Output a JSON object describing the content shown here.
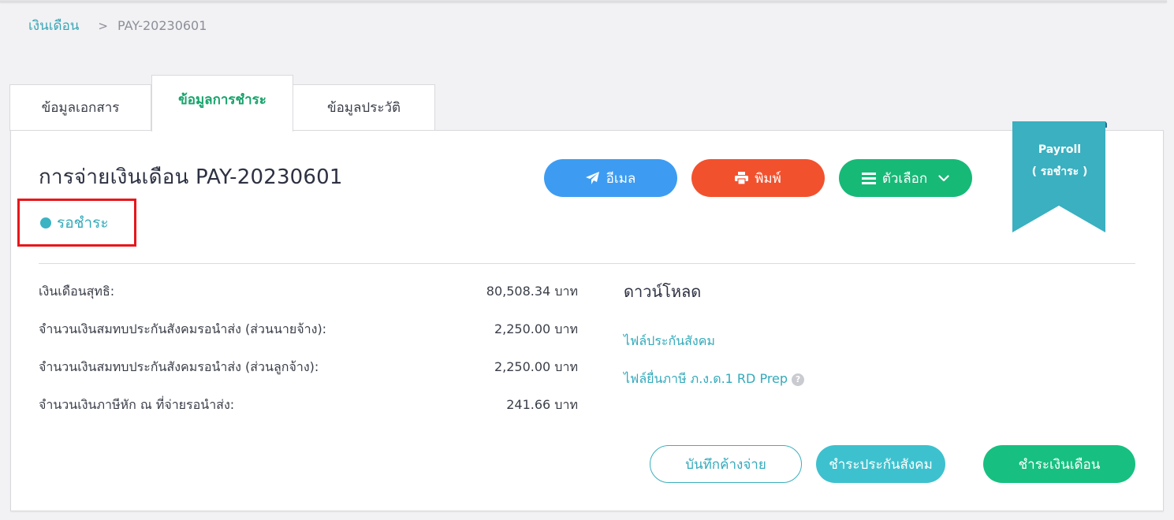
{
  "breadcrumb": {
    "parent": "เงินเดือน",
    "separator": ">",
    "current": "PAY-20230601"
  },
  "tabs": [
    {
      "label": "ข้อมูลเอกสาร",
      "active": false
    },
    {
      "label": "ข้อมูลการชำระ",
      "active": true
    },
    {
      "label": "ข้อมูลประวัติ",
      "active": false
    }
  ],
  "header": {
    "title": "การจ่ายเงินเดือน PAY-20230601",
    "status": "รอชำระ"
  },
  "actions": {
    "email_label": "อีเมล",
    "print_label": "พิมพ์",
    "options_label": "ตัวเลือก"
  },
  "ribbon": {
    "line1": "Payroll",
    "line2": "( รอชำระ )"
  },
  "summary": [
    {
      "label": "เงินเดือนสุทธิ:",
      "value": "80,508.34 บาท"
    },
    {
      "label": "จำนวนเงินสมทบประกันสังคมรอนำส่ง (ส่วนนายจ้าง):",
      "value": "2,250.00 บาท"
    },
    {
      "label": "จำนวนเงินสมทบประกันสังคมรอนำส่ง (ส่วนลูกจ้าง):",
      "value": "2,250.00 บาท"
    },
    {
      "label": "จำนวนเงินภาษีหัก ณ ที่จ่ายรอนำส่ง:",
      "value": "241.66 บาท"
    }
  ],
  "download": {
    "title": "ดาวน์โหลด",
    "links": [
      {
        "label": "ไฟล์ประกันสังคม"
      },
      {
        "label": "ไฟล์ยื่นภาษี ภ.ง.ด.1 RD Prep"
      }
    ]
  },
  "footer": {
    "record_pending_label": "บันทึกค้างจ่าย",
    "pay_social_label": "ชำระประกันสังคม",
    "pay_salary_label": "ชำระเงินเดือน"
  },
  "colors": {
    "email": "#3d9cf2",
    "print": "#f2512e",
    "options": "#17b977",
    "ribbon": "#3ab0c0",
    "status": "#33aabb",
    "highlight": "#e8161b",
    "pay_social": "#3ec1ce",
    "pay_salary": "#17c080"
  },
  "icons": {
    "email": "paper-plane-icon",
    "print": "printer-icon",
    "options": "hamburger-menu-icon",
    "options_caret": "chevron-down-icon",
    "help": "question-circle-icon"
  }
}
